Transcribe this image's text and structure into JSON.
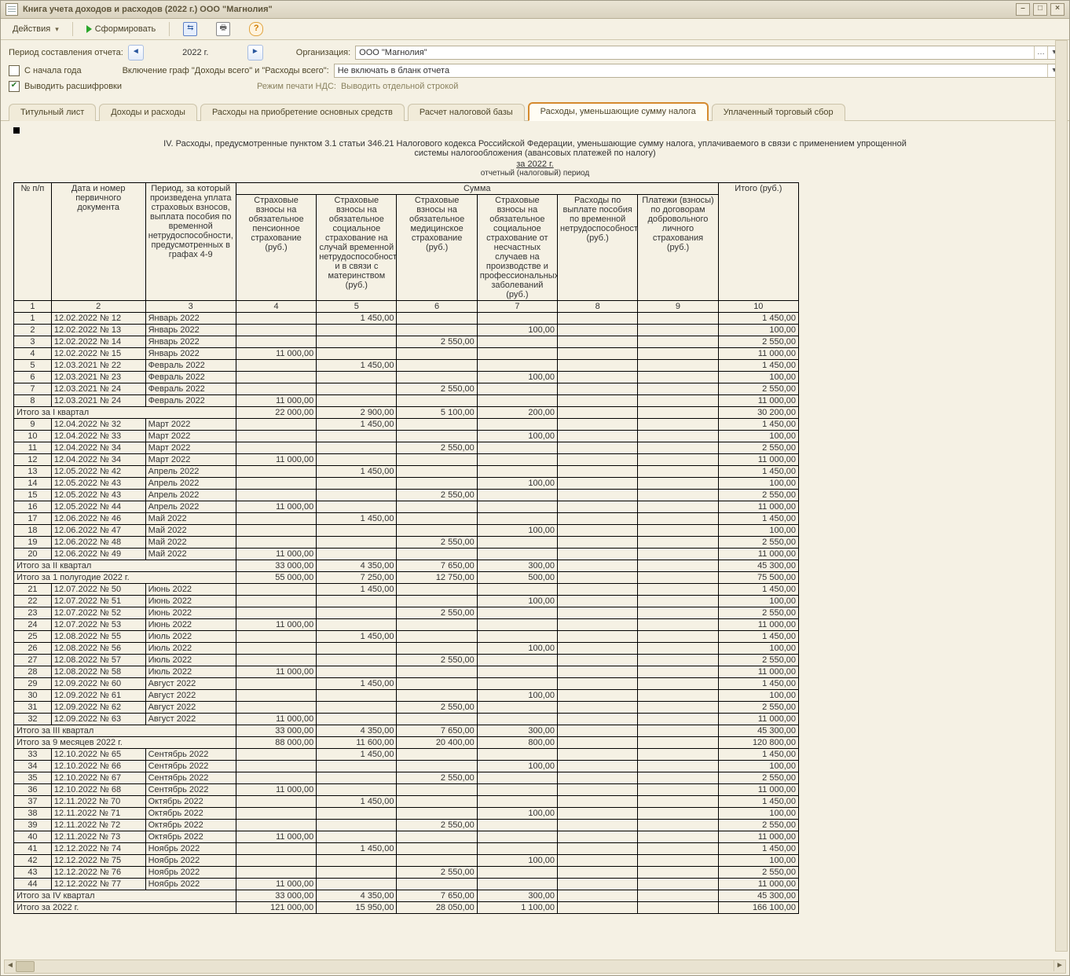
{
  "window": {
    "title": "Книга учета доходов и расходов (2022 г.) ООО \"Магнолия\""
  },
  "toolbar": {
    "actions": "Действия",
    "form": "Сформировать"
  },
  "params": {
    "period_label": "Период составления отчета:",
    "year": "2022 г.",
    "org_label": "Организация:",
    "org_value": "ООО \"Магнолия\"",
    "from_start": "С начала года",
    "include_label": "Включение граф \"Доходы всего\" и \"Расходы всего\":",
    "include_value": "Не включать в бланк отчета",
    "decode": "Выводить расшифровки",
    "vat_mode_label": "Режим печати НДС:",
    "vat_mode_value": "Выводить отдельной строкой"
  },
  "tabs": [
    "Титульный лист",
    "Доходы и расходы",
    "Расходы на приобретение основных средств",
    "Расчет налоговой базы",
    "Расходы, уменьшающие сумму налога",
    "Уплаченный торговый сбор"
  ],
  "active_tab": 4,
  "report": {
    "title": "IV. Расходы, предусмотренные пунктом 3.1 статьи 346.21 Налогового кодекса Российской Федерации, уменьшающие сумму налога, уплачиваемого в связи с применением упрощенной системы налогообложения (авансовых платежей по налогу)",
    "for_year": "за 2022 г.",
    "sub": "отчетный (налоговый) период"
  },
  "columns": {
    "c1": "№ п/п",
    "c2": "Дата и номер первичного документа",
    "c3": "Период, за который произведена уплата страховых взносов, выплата пособия по временной нетрудоспособности, предусмотренных в графах 4-9",
    "sum": "Сумма",
    "c4": "Страховые взносы на обязательное пенсионное страхование (руб.)",
    "c5": "Страховые взносы на обязательное социальное страхование на случай временной нетрудоспособности и в связи с материнством (руб.)",
    "c6": "Страховые взносы на обязательное медицинское страхование (руб.)",
    "c7": "Страховые взносы на обязательное социальное страхование от несчастных случаев на производстве и профессиональных заболеваний (руб.)",
    "c8": "Расходы по выплате пособия по временной нетрудоспособности (руб.)",
    "c9": "Платежи (взносы) по договорам добровольного личного страхования (руб.)",
    "c10": "Итого (руб.)"
  },
  "colnums": [
    "1",
    "2",
    "3",
    "4",
    "5",
    "6",
    "7",
    "8",
    "9",
    "10"
  ],
  "rows": [
    {
      "n": "1",
      "doc": "12.02.2022 № 12",
      "per": "Январь 2022",
      "v": [
        "",
        "1 450,00",
        "",
        "",
        "",
        ""
      ],
      "t": "1 450,00"
    },
    {
      "n": "2",
      "doc": "12.02.2022 № 13",
      "per": "Январь 2022",
      "v": [
        "",
        "",
        "",
        "100,00",
        "",
        ""
      ],
      "t": "100,00"
    },
    {
      "n": "3",
      "doc": "12.02.2022 № 14",
      "per": "Январь 2022",
      "v": [
        "",
        "",
        "2 550,00",
        "",
        "",
        ""
      ],
      "t": "2 550,00"
    },
    {
      "n": "4",
      "doc": "12.02.2022 № 15",
      "per": "Январь 2022",
      "v": [
        "11 000,00",
        "",
        "",
        "",
        "",
        ""
      ],
      "t": "11 000,00"
    },
    {
      "n": "5",
      "doc": "12.03.2021 № 22",
      "per": "Февраль 2022",
      "v": [
        "",
        "1 450,00",
        "",
        "",
        "",
        ""
      ],
      "t": "1 450,00"
    },
    {
      "n": "6",
      "doc": "12.03.2021 № 23",
      "per": "Февраль 2022",
      "v": [
        "",
        "",
        "",
        "100,00",
        "",
        ""
      ],
      "t": "100,00"
    },
    {
      "n": "7",
      "doc": "12.03.2021 № 24",
      "per": "Февраль 2022",
      "v": [
        "",
        "",
        "2 550,00",
        "",
        "",
        ""
      ],
      "t": "2 550,00"
    },
    {
      "n": "8",
      "doc": "12.03.2021 № 24",
      "per": "Февраль 2022",
      "v": [
        "11 000,00",
        "",
        "",
        "",
        "",
        ""
      ],
      "t": "11 000,00"
    },
    {
      "sum": "Итого за I квартал",
      "v": [
        "22 000,00",
        "2 900,00",
        "5 100,00",
        "200,00",
        "",
        ""
      ],
      "t": "30 200,00"
    },
    {
      "n": "9",
      "doc": "12.04.2022 № 32",
      "per": "Март 2022",
      "v": [
        "",
        "1 450,00",
        "",
        "",
        "",
        ""
      ],
      "t": "1 450,00"
    },
    {
      "n": "10",
      "doc": "12.04.2022 № 33",
      "per": "Март 2022",
      "v": [
        "",
        "",
        "",
        "100,00",
        "",
        ""
      ],
      "t": "100,00"
    },
    {
      "n": "11",
      "doc": "12.04.2022 № 34",
      "per": "Март 2022",
      "v": [
        "",
        "",
        "2 550,00",
        "",
        "",
        ""
      ],
      "t": "2 550,00"
    },
    {
      "n": "12",
      "doc": "12.04.2022 № 34",
      "per": "Март 2022",
      "v": [
        "11 000,00",
        "",
        "",
        "",
        "",
        ""
      ],
      "t": "11 000,00"
    },
    {
      "n": "13",
      "doc": "12.05.2022 № 42",
      "per": "Апрель 2022",
      "v": [
        "",
        "1 450,00",
        "",
        "",
        "",
        ""
      ],
      "t": "1 450,00"
    },
    {
      "n": "14",
      "doc": "12.05.2022 № 43",
      "per": "Апрель 2022",
      "v": [
        "",
        "",
        "",
        "100,00",
        "",
        ""
      ],
      "t": "100,00"
    },
    {
      "n": "15",
      "doc": "12.05.2022 № 43",
      "per": "Апрель 2022",
      "v": [
        "",
        "",
        "2 550,00",
        "",
        "",
        ""
      ],
      "t": "2 550,00"
    },
    {
      "n": "16",
      "doc": "12.05.2022 № 44",
      "per": "Апрель 2022",
      "v": [
        "11 000,00",
        "",
        "",
        "",
        "",
        ""
      ],
      "t": "11 000,00"
    },
    {
      "n": "17",
      "doc": "12.06.2022 № 46",
      "per": "Май 2022",
      "v": [
        "",
        "1 450,00",
        "",
        "",
        "",
        ""
      ],
      "t": "1 450,00"
    },
    {
      "n": "18",
      "doc": "12.06.2022 № 47",
      "per": "Май 2022",
      "v": [
        "",
        "",
        "",
        "100,00",
        "",
        ""
      ],
      "t": "100,00"
    },
    {
      "n": "19",
      "doc": "12.06.2022 № 48",
      "per": "Май 2022",
      "v": [
        "",
        "",
        "2 550,00",
        "",
        "",
        ""
      ],
      "t": "2 550,00"
    },
    {
      "n": "20",
      "doc": "12.06.2022 № 49",
      "per": "Май 2022",
      "v": [
        "11 000,00",
        "",
        "",
        "",
        "",
        ""
      ],
      "t": "11 000,00"
    },
    {
      "sum": "Итого за II квартал",
      "v": [
        "33 000,00",
        "4 350,00",
        "7 650,00",
        "300,00",
        "",
        ""
      ],
      "t": "45 300,00"
    },
    {
      "sum": "Итого за 1 полугодие 2022 г.",
      "v": [
        "55 000,00",
        "7 250,00",
        "12 750,00",
        "500,00",
        "",
        ""
      ],
      "t": "75 500,00"
    },
    {
      "n": "21",
      "doc": "12.07.2022 № 50",
      "per": "Июнь 2022",
      "v": [
        "",
        "1 450,00",
        "",
        "",
        "",
        ""
      ],
      "t": "1 450,00"
    },
    {
      "n": "22",
      "doc": "12.07.2022 № 51",
      "per": "Июнь 2022",
      "v": [
        "",
        "",
        "",
        "100,00",
        "",
        ""
      ],
      "t": "100,00"
    },
    {
      "n": "23",
      "doc": "12.07.2022 № 52",
      "per": "Июнь 2022",
      "v": [
        "",
        "",
        "2 550,00",
        "",
        "",
        ""
      ],
      "t": "2 550,00"
    },
    {
      "n": "24",
      "doc": "12.07.2022 № 53",
      "per": "Июнь 2022",
      "v": [
        "11 000,00",
        "",
        "",
        "",
        "",
        ""
      ],
      "t": "11 000,00"
    },
    {
      "n": "25",
      "doc": "12.08.2022 № 55",
      "per": "Июль 2022",
      "v": [
        "",
        "1 450,00",
        "",
        "",
        "",
        ""
      ],
      "t": "1 450,00"
    },
    {
      "n": "26",
      "doc": "12.08.2022 № 56",
      "per": "Июль 2022",
      "v": [
        "",
        "",
        "",
        "100,00",
        "",
        ""
      ],
      "t": "100,00"
    },
    {
      "n": "27",
      "doc": "12.08.2022 № 57",
      "per": "Июль 2022",
      "v": [
        "",
        "",
        "2 550,00",
        "",
        "",
        ""
      ],
      "t": "2 550,00"
    },
    {
      "n": "28",
      "doc": "12.08.2022 № 58",
      "per": "Июль 2022",
      "v": [
        "11 000,00",
        "",
        "",
        "",
        "",
        ""
      ],
      "t": "11 000,00"
    },
    {
      "n": "29",
      "doc": "12.09.2022 № 60",
      "per": "Август 2022",
      "v": [
        "",
        "1 450,00",
        "",
        "",
        "",
        ""
      ],
      "t": "1 450,00"
    },
    {
      "n": "30",
      "doc": "12.09.2022 № 61",
      "per": "Август 2022",
      "v": [
        "",
        "",
        "",
        "100,00",
        "",
        ""
      ],
      "t": "100,00"
    },
    {
      "n": "31",
      "doc": "12.09.2022 № 62",
      "per": "Август 2022",
      "v": [
        "",
        "",
        "2 550,00",
        "",
        "",
        ""
      ],
      "t": "2 550,00"
    },
    {
      "n": "32",
      "doc": "12.09.2022 № 63",
      "per": "Август 2022",
      "v": [
        "11 000,00",
        "",
        "",
        "",
        "",
        ""
      ],
      "t": "11 000,00"
    },
    {
      "sum": "Итого за III квартал",
      "v": [
        "33 000,00",
        "4 350,00",
        "7 650,00",
        "300,00",
        "",
        ""
      ],
      "t": "45 300,00"
    },
    {
      "sum": "Итого за 9 месяцев 2022 г.",
      "v": [
        "88 000,00",
        "11 600,00",
        "20 400,00",
        "800,00",
        "",
        ""
      ],
      "t": "120 800,00"
    },
    {
      "n": "33",
      "doc": "12.10.2022 № 65",
      "per": "Сентябрь 2022",
      "v": [
        "",
        "1 450,00",
        "",
        "",
        "",
        ""
      ],
      "t": "1 450,00"
    },
    {
      "n": "34",
      "doc": "12.10.2022 № 66",
      "per": "Сентябрь 2022",
      "v": [
        "",
        "",
        "",
        "100,00",
        "",
        ""
      ],
      "t": "100,00"
    },
    {
      "n": "35",
      "doc": "12.10.2022 № 67",
      "per": "Сентябрь 2022",
      "v": [
        "",
        "",
        "2 550,00",
        "",
        "",
        ""
      ],
      "t": "2 550,00"
    },
    {
      "n": "36",
      "doc": "12.10.2022 № 68",
      "per": "Сентябрь 2022",
      "v": [
        "11 000,00",
        "",
        "",
        "",
        "",
        ""
      ],
      "t": "11 000,00"
    },
    {
      "n": "37",
      "doc": "12.11.2022 № 70",
      "per": "Октябрь 2022",
      "v": [
        "",
        "1 450,00",
        "",
        "",
        "",
        ""
      ],
      "t": "1 450,00"
    },
    {
      "n": "38",
      "doc": "12.11.2022 № 71",
      "per": "Октябрь 2022",
      "v": [
        "",
        "",
        "",
        "100,00",
        "",
        ""
      ],
      "t": "100,00"
    },
    {
      "n": "39",
      "doc": "12.11.2022 № 72",
      "per": "Октябрь 2022",
      "v": [
        "",
        "",
        "2 550,00",
        "",
        "",
        ""
      ],
      "t": "2 550,00"
    },
    {
      "n": "40",
      "doc": "12.11.2022 № 73",
      "per": "Октябрь 2022",
      "v": [
        "11 000,00",
        "",
        "",
        "",
        "",
        ""
      ],
      "t": "11 000,00"
    },
    {
      "n": "41",
      "doc": "12.12.2022 № 74",
      "per": "Ноябрь 2022",
      "v": [
        "",
        "1 450,00",
        "",
        "",
        "",
        ""
      ],
      "t": "1 450,00"
    },
    {
      "n": "42",
      "doc": "12.12.2022 № 75",
      "per": "Ноябрь 2022",
      "v": [
        "",
        "",
        "",
        "100,00",
        "",
        ""
      ],
      "t": "100,00"
    },
    {
      "n": "43",
      "doc": "12.12.2022 № 76",
      "per": "Ноябрь 2022",
      "v": [
        "",
        "",
        "2 550,00",
        "",
        "",
        ""
      ],
      "t": "2 550,00"
    },
    {
      "n": "44",
      "doc": "12.12.2022 № 77",
      "per": "Ноябрь 2022",
      "v": [
        "11 000,00",
        "",
        "",
        "",
        "",
        ""
      ],
      "t": "11 000,00"
    },
    {
      "sum": "Итого за IV квартал",
      "v": [
        "33 000,00",
        "4 350,00",
        "7 650,00",
        "300,00",
        "",
        ""
      ],
      "t": "45 300,00"
    },
    {
      "sum": "Итого за 2022 г.",
      "v": [
        "121 000,00",
        "15 950,00",
        "28 050,00",
        "1 100,00",
        "",
        ""
      ],
      "t": "166 100,00"
    }
  ]
}
